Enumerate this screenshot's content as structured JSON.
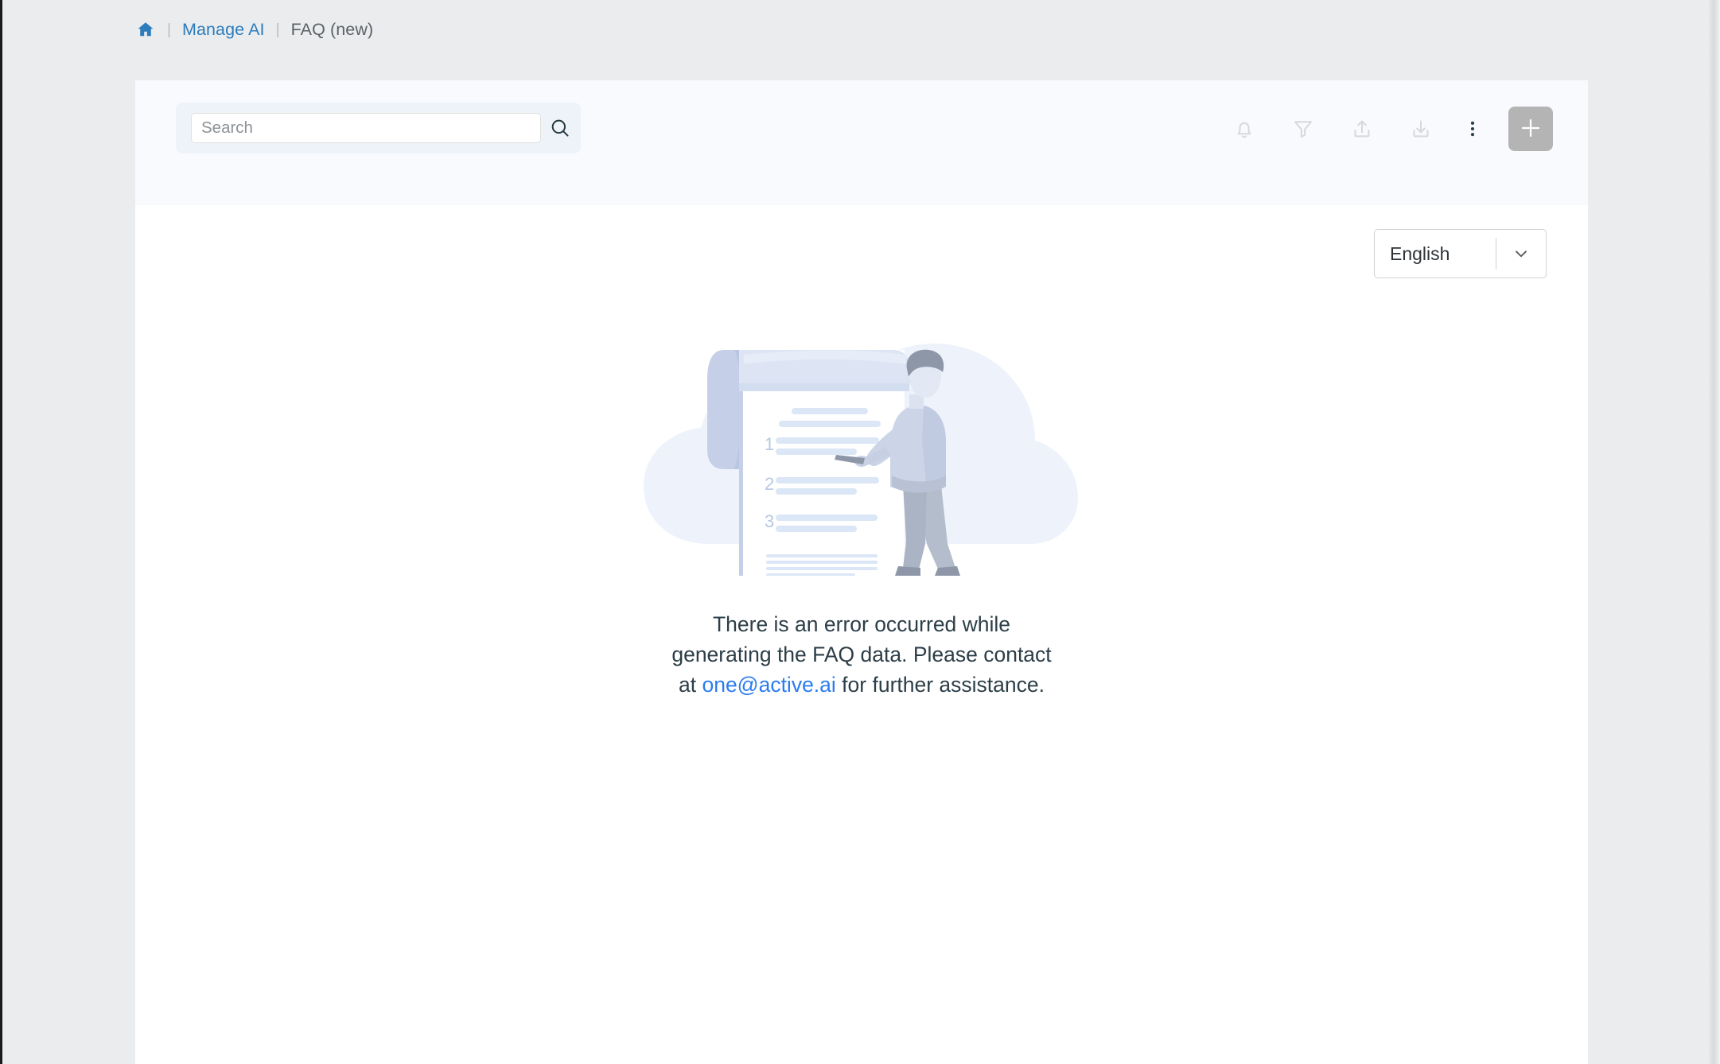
{
  "breadcrumb": {
    "home_icon": "home-icon",
    "separator": "|",
    "link_label": "Manage AI",
    "current_label": "FAQ (new)"
  },
  "toolbar": {
    "search": {
      "placeholder": "Search",
      "value": "",
      "icon": "search-icon"
    },
    "actions": [
      {
        "name": "notifications",
        "icon": "bell-icon"
      },
      {
        "name": "filter",
        "icon": "funnel-icon"
      },
      {
        "name": "upload",
        "icon": "upload-icon"
      },
      {
        "name": "download",
        "icon": "download-icon"
      },
      {
        "name": "more-options",
        "icon": "three-dots-vertical-icon"
      }
    ],
    "add_button": {
      "name": "add",
      "icon": "plus-icon"
    }
  },
  "language_selector": {
    "selected": "English",
    "chevron_icon": "chevron-down-icon"
  },
  "empty_state": {
    "illustration_name": "faq-document-person-illustration",
    "list_numbers": [
      "1",
      "2",
      "3"
    ],
    "message_part1": "There is an error occurred while generating the FAQ data. Please contact at ",
    "email": "one@active.ai",
    "message_part2": " for further assistance."
  },
  "colors": {
    "page_background": "#eaecee",
    "card_background": "#ffffff",
    "card_header_background": "#f8fafd",
    "breadcrumb_link": "#2d7cbb",
    "breadcrumb_current": "#5c6166",
    "search_container": "#eef2f9",
    "toolbar_icon": "#d6d8da",
    "dots_icon": "#2b3f47",
    "add_button": "#b4b4b4",
    "email_link": "#2b7cf0",
    "message_text": "#2c3e47",
    "illustration_cloud": "#eef2fa",
    "illustration_paper_curl": "#c5d0e8",
    "illustration_accent": "#dde5f4"
  }
}
